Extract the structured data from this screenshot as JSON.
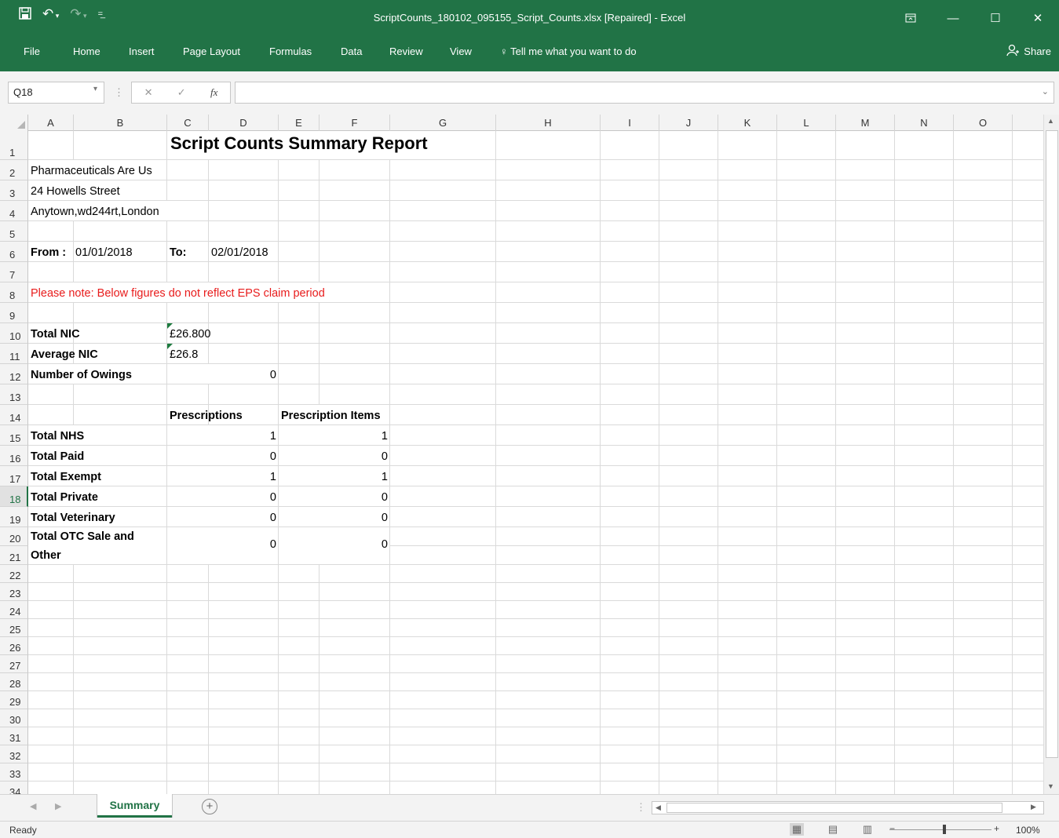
{
  "window": {
    "title": "ScriptCounts_180102_095155_Script_Counts.xlsx [Repaired]  -  Excel"
  },
  "ribbon": {
    "tabs": [
      "File",
      "Home",
      "Insert",
      "Page Layout",
      "Formulas",
      "Data",
      "Review",
      "View"
    ],
    "tell_me": "Tell me what you want to do",
    "share": "Share"
  },
  "formula_bar": {
    "name_box": "Q18",
    "formula": ""
  },
  "columns": [
    "A",
    "B",
    "C",
    "D",
    "E",
    "F",
    "G",
    "H",
    "I",
    "J",
    "K",
    "L",
    "M",
    "N",
    "O"
  ],
  "rows": [
    "1",
    "2",
    "3",
    "4",
    "5",
    "6",
    "7",
    "8",
    "9",
    "10",
    "11",
    "12",
    "13",
    "14",
    "15",
    "16",
    "17",
    "18",
    "19",
    "20",
    "21",
    "22",
    "23",
    "24",
    "25",
    "26",
    "27",
    "28",
    "29",
    "30",
    "31",
    "32",
    "33",
    "34"
  ],
  "selected_row": "18",
  "sheet": {
    "title": "Script Counts Summary Report",
    "company": "Pharmaceuticals Are Us",
    "street": "24 Howells Street",
    "town": "Anytown,wd244rt,London",
    "from_label": "From :",
    "from_value": "01/01/2018",
    "to_label": "To:",
    "to_value": "02/01/2018",
    "note": "Please note: Below figures do not reflect EPS claim period",
    "total_nic_label": "Total NIC",
    "total_nic_value": "£26.800",
    "average_nic_label": "Average NIC",
    "average_nic_value": "£26.8",
    "owings_label": "Number of Owings",
    "owings_value": "0",
    "col_prescriptions": "Prescriptions",
    "col_items": "Prescription Items",
    "table": [
      {
        "label": "Total NHS",
        "prescriptions": "1",
        "items": "1"
      },
      {
        "label": "Total Paid",
        "prescriptions": "0",
        "items": "0"
      },
      {
        "label": "Total Exempt",
        "prescriptions": "1",
        "items": "1"
      },
      {
        "label": "Total Private",
        "prescriptions": "0",
        "items": "0"
      },
      {
        "label": "Total Veterinary",
        "prescriptions": "0",
        "items": "0"
      }
    ],
    "otc_label_line1": "Total OTC Sale and",
    "otc_label_line2": "Other",
    "otc_prescriptions": "0",
    "otc_items": "0"
  },
  "sheet_tabs": {
    "active": "Summary",
    "add": "+"
  },
  "status": {
    "ready": "Ready",
    "zoom": "100%"
  },
  "colors": {
    "excel_green": "#217346",
    "note_red": "#e81c1c"
  }
}
